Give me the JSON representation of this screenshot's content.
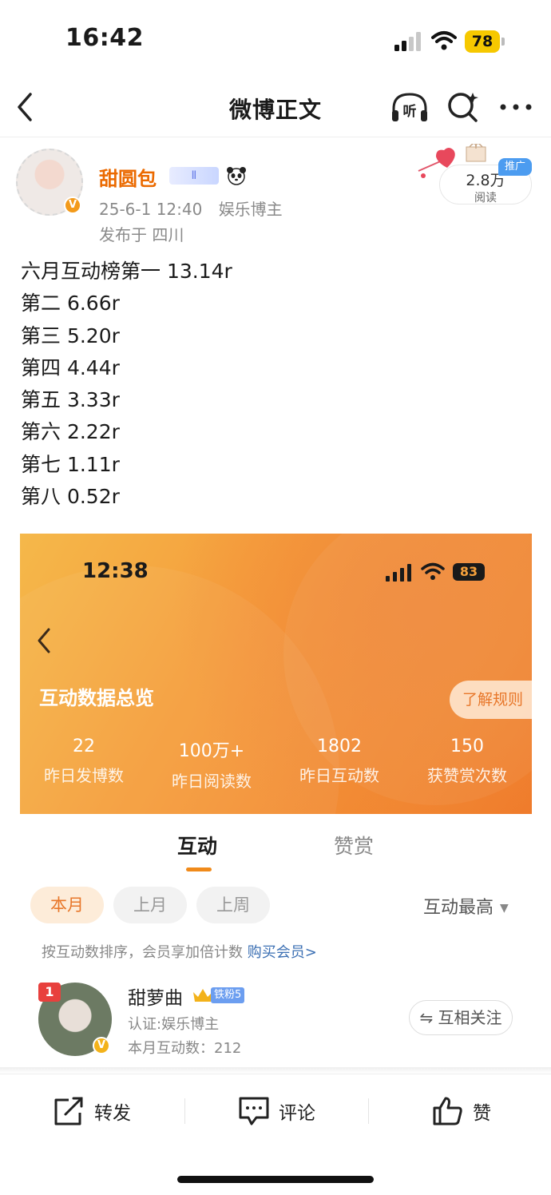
{
  "status_bar": {
    "time": "16:42",
    "battery": "78"
  },
  "nav": {
    "title": "微博正文",
    "listen_icon_label": "听"
  },
  "author": {
    "name": "甜圆包",
    "date": "25-6-1 12:40",
    "category": "娱乐博主",
    "location": "发布于 四川",
    "level_badge": "Ⅱ",
    "reads": {
      "count": "2.8万",
      "label": "阅读",
      "promo_tag": "推广"
    }
  },
  "post": {
    "lines": [
      "六月互动榜第一 13.14r",
      "第二 6.66r",
      "第三 5.20r",
      "第四 4.44r",
      "第五 3.33r",
      "第六 2.22r",
      "第七 1.11r",
      "第八 0.52r"
    ]
  },
  "embed": {
    "time": "12:38",
    "battery": "83",
    "title": "互动数据总览",
    "rules_button": "了解规则",
    "stats": [
      {
        "value": "22",
        "label": "昨日发博数"
      },
      {
        "value": "100万+",
        "label": "昨日阅读数"
      },
      {
        "value": "1802",
        "label": "昨日互动数"
      },
      {
        "value": "150",
        "label": "获赞赏次数"
      }
    ]
  },
  "tabs": {
    "active": "互动",
    "inactive": "赞赏"
  },
  "filters": {
    "this_month": "本月",
    "last_month": "上月",
    "last_week": "上周",
    "sort": "互动最高"
  },
  "hint": {
    "text": "按互动数排序，会员享加倍计数 ",
    "link": "购买会员>"
  },
  "user": {
    "rank": "1",
    "name": "甜萝曲",
    "fan_level": "铁粉5",
    "cert": "认证:娱乐博主",
    "count": "本月互动数：212",
    "follow": "⇋ 互相关注"
  },
  "toolbar": {
    "repost": "转发",
    "comment": "评论",
    "like": "赞"
  },
  "colors": {
    "accent": "#eb6a00",
    "orange_gradient_start": "#f5b84a",
    "orange_gradient_end": "#ef7a2a",
    "link": "#3b6fb3",
    "rank_red": "#e8403d"
  }
}
